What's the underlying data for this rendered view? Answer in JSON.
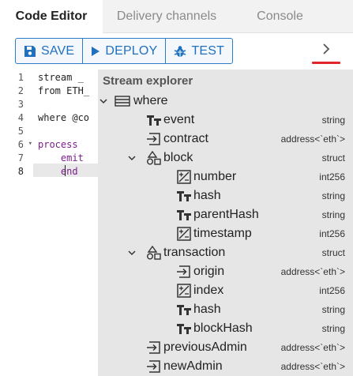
{
  "tabs": [
    {
      "label": "Code Editor",
      "active": true
    },
    {
      "label": "Delivery channels",
      "active": false
    },
    {
      "label": "Console",
      "active": false
    }
  ],
  "toolbar": {
    "save_label": "SAVE",
    "deploy_label": "DEPLOY",
    "test_label": "TEST",
    "accent_color": "#1f70bd",
    "underline_color": "#e0262b"
  },
  "editor": {
    "lines": [
      {
        "num": "1",
        "text": "stream _",
        "fold": ""
      },
      {
        "num": "2",
        "text": "from ETH_",
        "fold": ""
      },
      {
        "num": "3",
        "text": "",
        "fold": ""
      },
      {
        "num": "4",
        "text": "where @co",
        "fold": ""
      },
      {
        "num": "5",
        "text": "",
        "fold": ""
      },
      {
        "num": "6",
        "text": "process",
        "fold": "▾"
      },
      {
        "num": "7",
        "text": "    emit",
        "fold": ""
      },
      {
        "num": "8",
        "text": "    end",
        "fold": ""
      }
    ],
    "active_line": "8"
  },
  "explorer": {
    "title": "Stream explorer",
    "rows": [
      {
        "depth": 0,
        "chevron": true,
        "icon": "table-icon",
        "label": "where",
        "type": ""
      },
      {
        "depth": 1,
        "chevron": false,
        "icon": "text-icon",
        "label": "event",
        "type": "string"
      },
      {
        "depth": 1,
        "chevron": false,
        "icon": "address-icon",
        "label": "contract",
        "type": "address<`eth`>"
      },
      {
        "depth": 1,
        "chevron": true,
        "icon": "struct-icon",
        "label": "block",
        "type": "struct"
      },
      {
        "depth": 2,
        "chevron": false,
        "icon": "number-icon",
        "label": "number",
        "type": "int256"
      },
      {
        "depth": 2,
        "chevron": false,
        "icon": "text-icon",
        "label": "hash",
        "type": "string"
      },
      {
        "depth": 2,
        "chevron": false,
        "icon": "text-icon",
        "label": "parentHash",
        "type": "string"
      },
      {
        "depth": 2,
        "chevron": false,
        "icon": "number-icon",
        "label": "timestamp",
        "type": "int256"
      },
      {
        "depth": 1,
        "chevron": true,
        "icon": "struct-icon",
        "label": "transaction",
        "type": "struct"
      },
      {
        "depth": 2,
        "chevron": false,
        "icon": "address-icon",
        "label": "origin",
        "type": "address<`eth`>"
      },
      {
        "depth": 2,
        "chevron": false,
        "icon": "number-icon",
        "label": "index",
        "type": "int256"
      },
      {
        "depth": 2,
        "chevron": false,
        "icon": "text-icon",
        "label": "hash",
        "type": "string"
      },
      {
        "depth": 2,
        "chevron": false,
        "icon": "text-icon",
        "label": "blockHash",
        "type": "string"
      },
      {
        "depth": 1,
        "chevron": false,
        "icon": "address-icon",
        "label": "previousAdmin",
        "type": "address<`eth`>"
      },
      {
        "depth": 1,
        "chevron": false,
        "icon": "address-icon",
        "label": "newAdmin",
        "type": "address<`eth`>"
      }
    ]
  }
}
